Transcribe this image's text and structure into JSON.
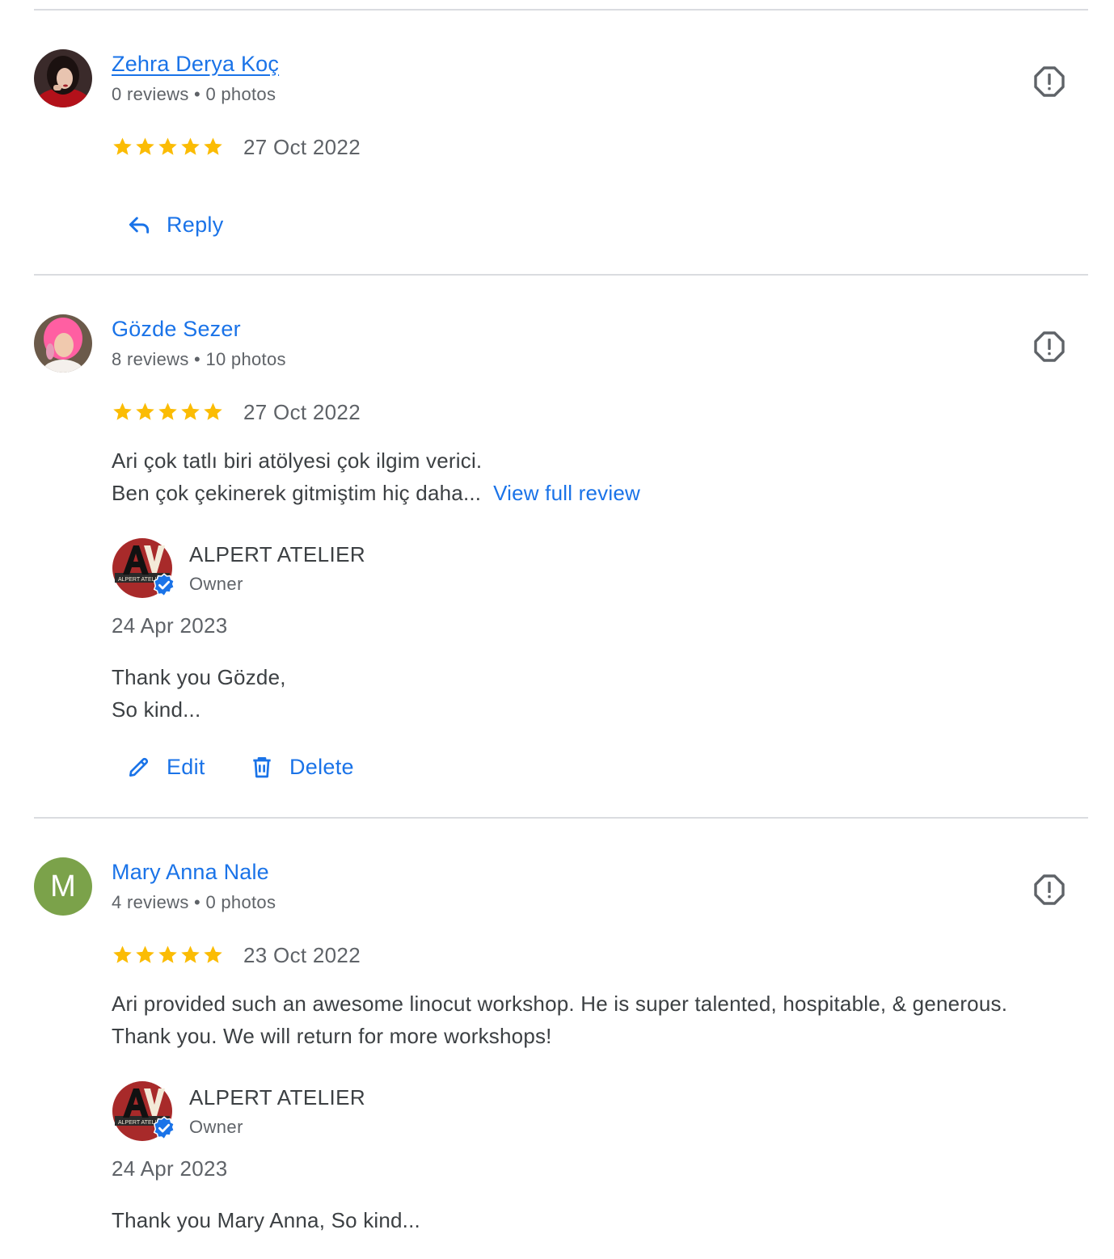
{
  "reviews": [
    {
      "name": "Zehra Derya Koç",
      "meta": "0 reviews • 0 photos",
      "rating": 5,
      "date": "27 Oct 2022",
      "reply_label": "Reply"
    },
    {
      "name": "Gözde Sezer",
      "meta": "8 reviews • 10 photos",
      "rating": 5,
      "date": "27 Oct 2022",
      "text_line1": "Ari çok tatlı biri atölyesi çok ilgim verici.",
      "text_line2": "Ben çok çekinerek gitmiştim hiç daha...",
      "view_full": "View full review",
      "owner": {
        "name": "ALPERT ATELIER",
        "role": "Owner",
        "date": "24 Apr 2023",
        "text_line1": "Thank you Gözde,",
        "text_line2": "So kind...",
        "logo_text": "ALPERT ATELIER"
      },
      "edit_label": "Edit",
      "delete_label": "Delete"
    },
    {
      "name": "Mary Anna Nale",
      "avatar_letter": "M",
      "meta": "4 reviews • 0 photos",
      "rating": 5,
      "date": "23 Oct 2022",
      "text_line1": "Ari provided such an awesome linocut workshop. He is super talented, hospitable, & generous.",
      "text_line2": "Thank you. We will return for more workshops!",
      "owner": {
        "name": "ALPERT ATELIER",
        "role": "Owner",
        "date": "24 Apr 2023",
        "text_line1": "Thank you Mary Anna, So kind...",
        "logo_text": "ALPERT ATELIER"
      }
    }
  ],
  "colors": {
    "link": "#1a73e8",
    "star": "#fbbc04",
    "text": "#3c4043",
    "muted": "#5f6368",
    "avatar_green": "#7ba24a",
    "verified": "#1a73e8"
  },
  "icons": [
    "report-flag-icon",
    "reply-icon",
    "edit-pencil-icon",
    "delete-trash-icon",
    "star-icon",
    "verified-badge-icon"
  ]
}
